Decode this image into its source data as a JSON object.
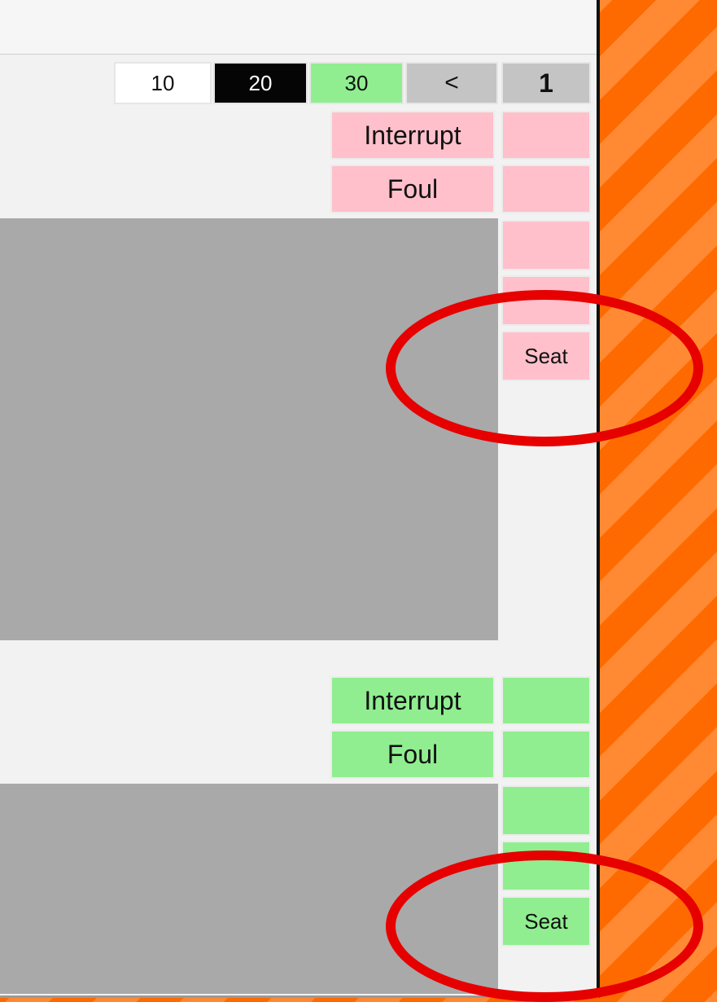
{
  "pager": {
    "buttons": [
      "10",
      "20",
      "30"
    ],
    "prev_label": "<",
    "page": "1"
  },
  "section_pink": {
    "color": "#ffc0cb",
    "interrupt_label": "Interrupt",
    "foul_label": "Foul",
    "seat_label": "Seat"
  },
  "section_green": {
    "color": "#90ee90",
    "interrupt_label": "Interrupt",
    "foul_label": "Foul",
    "seat_label": "Seat"
  },
  "annotation": {
    "color": "#e60000",
    "shape": "ellipse"
  }
}
